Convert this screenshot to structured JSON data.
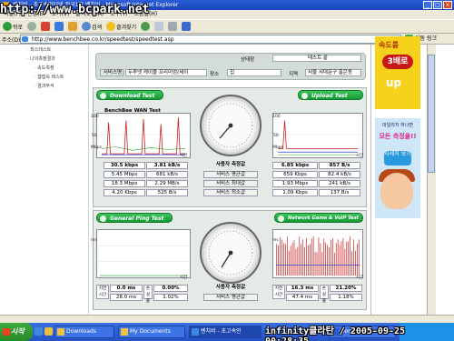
{
  "watermark": "http://www.bcpark.net",
  "window": {
    "title": "벤치비 - 초고속인터넷 전국1위 벤치비 - Microsoft Internet Explorer",
    "min": "_",
    "max": "□",
    "close": "×"
  },
  "menubar": {
    "items": [
      "파일(F)",
      "편집(E)",
      "보기(V)",
      "즐겨찾기(A)",
      "도구(T)",
      "도움말(H)"
    ]
  },
  "toolbar": {
    "back": "뒤로",
    "search": "검색",
    "favorites": "즐겨찾기"
  },
  "address": {
    "label": "주소(D)",
    "url": "http://www.benchbee.co.kr/speedtest/speedtest.asp",
    "go": "이동",
    "links": "링크"
  },
  "leftnav": {
    "items": [
      "· 최스테스트",
      "· 나의측정결과",
      "· 속도측정",
      "· 웹접속 테스트",
      "· 결과부석"
    ]
  },
  "ads": {
    "ad1_top": "속도를",
    "ad1_mid": "3배로",
    "ad1_bottom": "up",
    "ad2_top": "마일리지 하나면",
    "ad2_mid": "모든 측정을!!",
    "ad2_btn": "자세히 보기"
  },
  "status": {
    "state_label": "상태창",
    "state_value": "테스트 끝",
    "isp_label": "서비스명",
    "isp_value": "두루넷 케이블 프리미엄(세이",
    "place_label": "장소",
    "place_value": "집",
    "region_label": "지역",
    "region_value": "서울 서대문구 홍은동"
  },
  "wan": {
    "title": "BenchBee WAN Test",
    "download_btn": "Download Test",
    "upload_btn": "Upload Test",
    "download_graph": {
      "y_top": "100",
      "y_mid": "50",
      "x_label": "시간",
      "y_label": "Mbps"
    },
    "upload_graph": {
      "y_top": "100",
      "y_mid": "50",
      "x_label": "시간",
      "y_label": "Mbps"
    },
    "download_rows": [
      [
        "30.5 kbps",
        "3.81 kB/s"
      ],
      [
        "5.45 Mbps",
        "681 kB/s"
      ],
      [
        "18.3 Mbps",
        "2.29 MB/s"
      ],
      [
        "4.20 Kbps",
        "525 B/s"
      ]
    ],
    "labels": [
      "사용자 측정값",
      "서비스 평균값",
      "서비스 최대값",
      "서비스 최소값"
    ],
    "upload_rows": [
      [
        "6.85 kbps",
        "857 B/s"
      ],
      [
        "659 Kbps",
        "82.4 kB/s"
      ],
      [
        "1.93 Mbps",
        "241 kB/s"
      ],
      [
        "1.09 Kbps",
        "137 B/s"
      ]
    ]
  },
  "ping": {
    "general_btn": "General Ping Test",
    "game_btn": "Network Game & VoIP Test",
    "left_graph": {
      "y_label": "ms",
      "x_label": "시간"
    },
    "right_graph": {
      "y_label": "ms",
      "x_label": "시간"
    },
    "left_heads": [
      "지연 시간",
      "손실률"
    ],
    "right_heads": [
      "지연 시간",
      "손실률"
    ],
    "left_rows": [
      [
        "0.0 ms",
        "0.00%"
      ],
      [
        "28.0 ms",
        "1.02%"
      ]
    ],
    "labels": [
      "사용자 측정값",
      "서비스 평균값"
    ],
    "right_rows": [
      [
        "16.3 ms",
        "21.20%"
      ],
      [
        "47.4 ms",
        "1.18%"
      ]
    ]
  },
  "statusbar": {
    "text": ""
  },
  "taskbar": {
    "start": "시작",
    "tasks": [
      "Downloads",
      "My Documents",
      "벤치비 - 초고속인",
      "Document1"
    ],
    "overlay": "infinity클라탄 / 2005-09-25 00:28:35"
  }
}
